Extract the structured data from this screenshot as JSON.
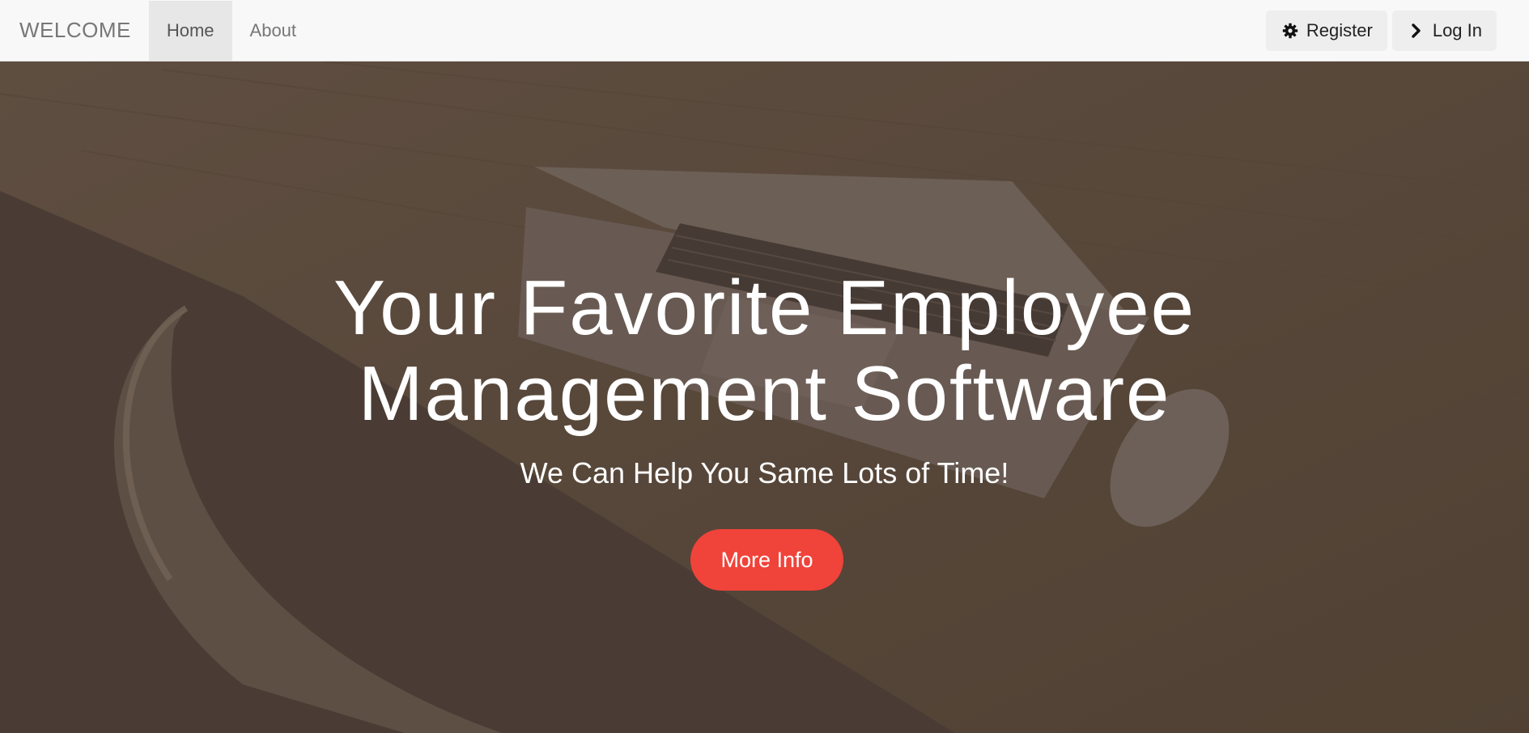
{
  "navbar": {
    "brand": "WELCOME",
    "links": [
      {
        "label": "Home",
        "active": true
      },
      {
        "label": "About",
        "active": false
      }
    ],
    "register": {
      "label": "Register",
      "icon": "gear-icon"
    },
    "login": {
      "label": "Log In",
      "icon": "chevron-right-icon"
    }
  },
  "hero": {
    "title_line1": "Your Favorite Employee",
    "title_line2": "Management Software",
    "subtitle": "We Can Help You Same Lots of Time!",
    "cta_label": "More Info"
  },
  "colors": {
    "navbar_bg": "#f8f8f8",
    "hero_overlay": "#4f4138",
    "cta": "#f0433a"
  }
}
